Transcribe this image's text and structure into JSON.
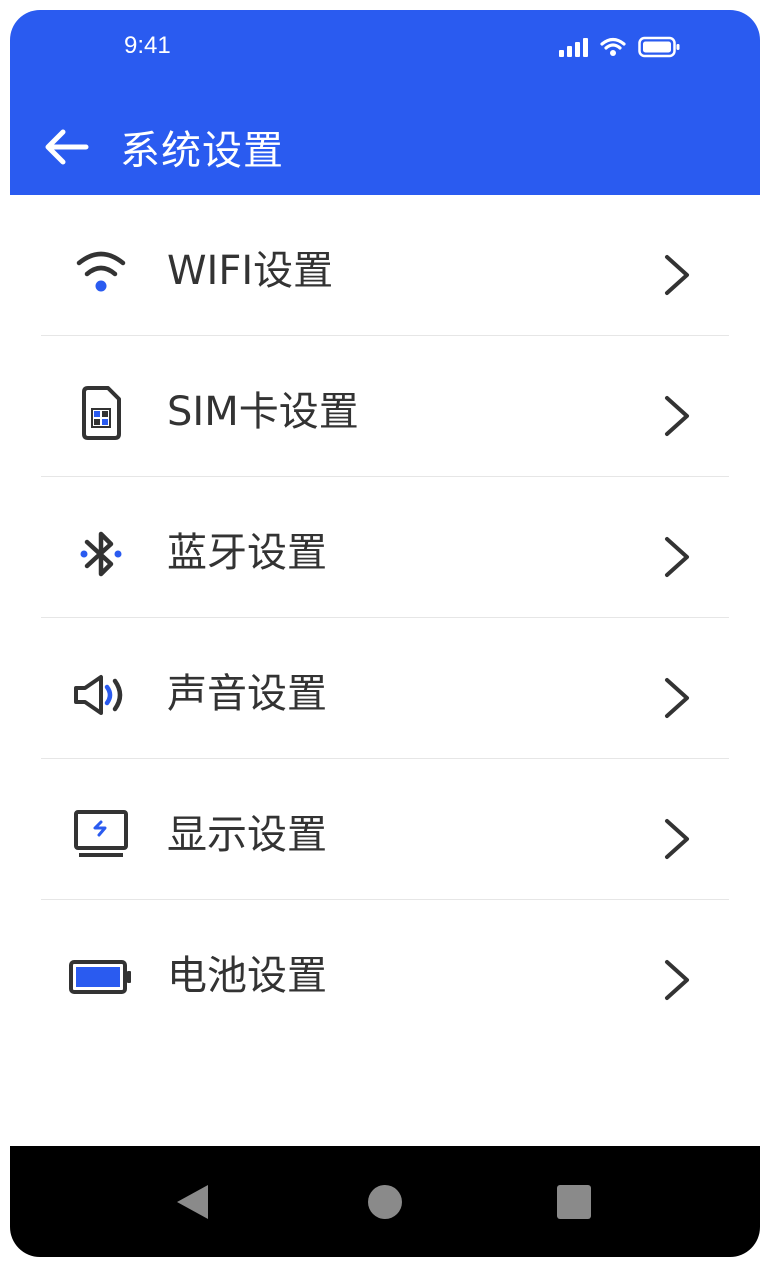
{
  "status_bar": {
    "time": "9:41"
  },
  "header": {
    "title": "系统设置",
    "back_icon": "arrow-left-icon"
  },
  "menu": {
    "items": [
      {
        "label": "WIFI设置",
        "icon": "wifi-icon"
      },
      {
        "label": "SIM卡设置",
        "icon": "sim-card-icon"
      },
      {
        "label": "蓝牙设置",
        "icon": "bluetooth-icon"
      },
      {
        "label": "声音设置",
        "icon": "speaker-icon"
      },
      {
        "label": "显示设置",
        "icon": "display-icon"
      },
      {
        "label": "电池设置",
        "icon": "battery-icon"
      }
    ]
  },
  "nav_bar": {
    "buttons": [
      "nav-back-icon",
      "nav-home-icon",
      "nav-recents-icon"
    ]
  },
  "colors": {
    "accent": "#2a5bf0",
    "text": "#333333",
    "nav_bar": "#000000",
    "nav_icons": "#8a8a8a"
  }
}
